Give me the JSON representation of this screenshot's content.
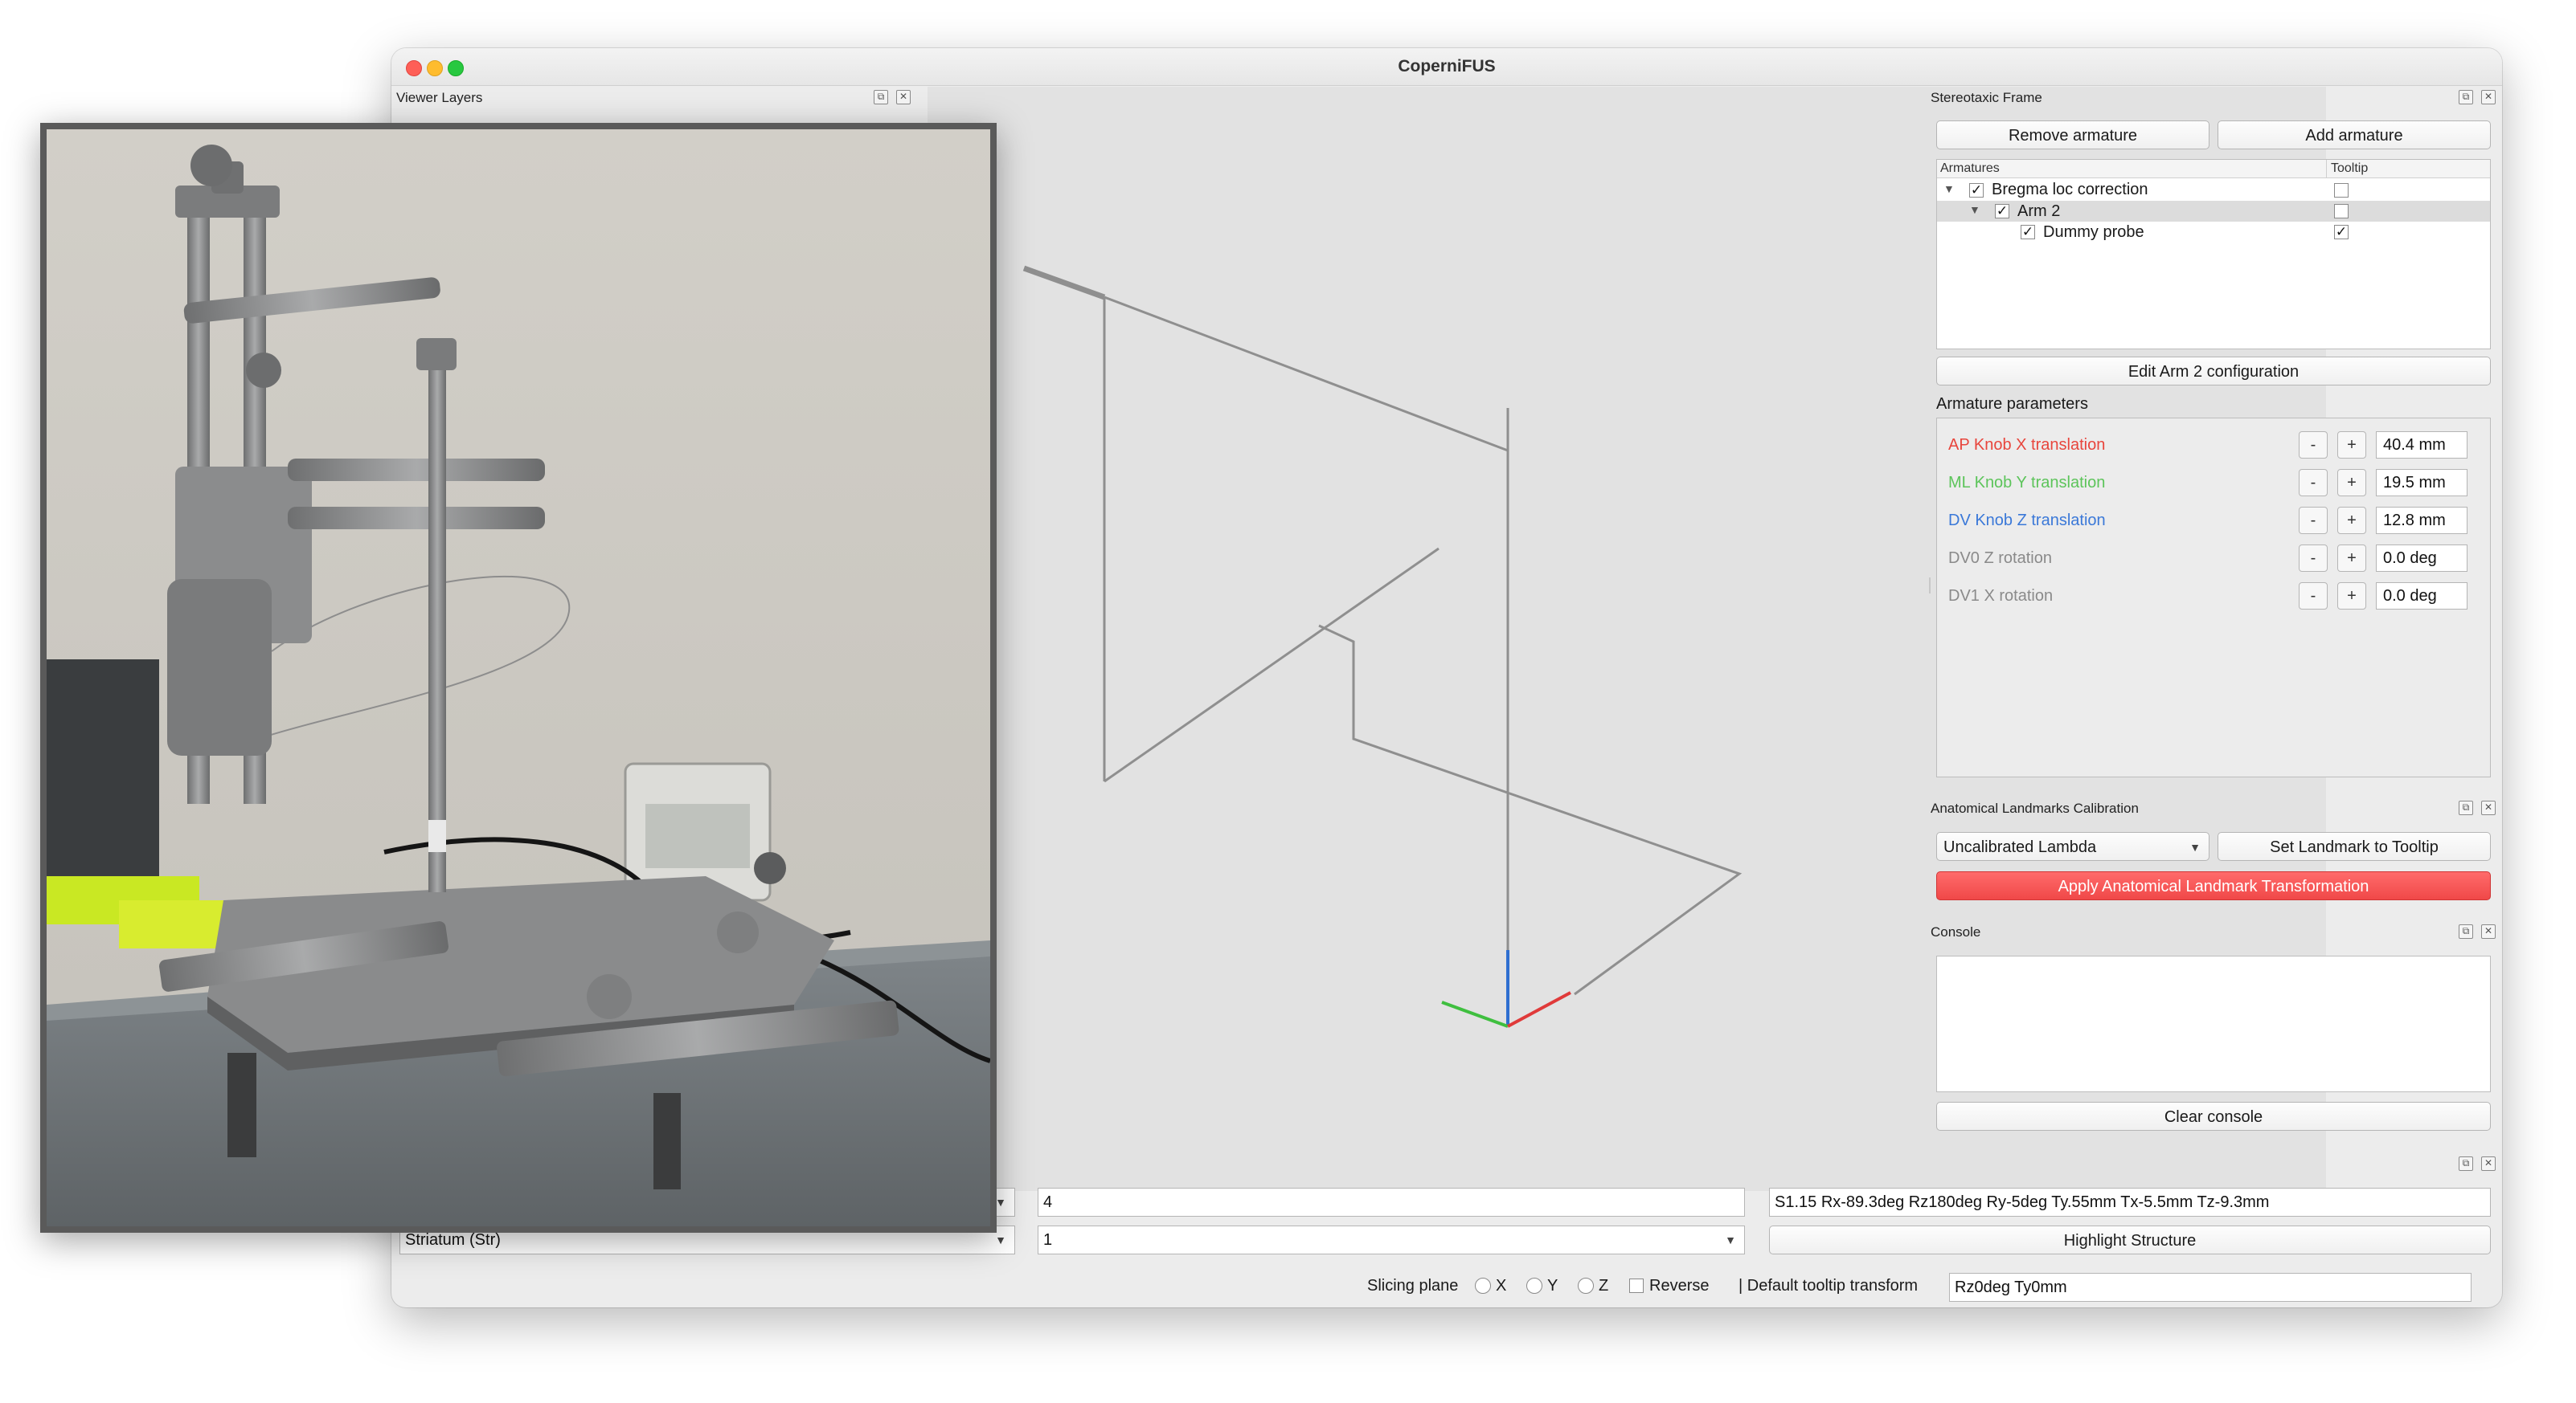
{
  "window": {
    "title": "CoperniFUS"
  },
  "viewer_layers": {
    "title": "Viewer Layers"
  },
  "stereotaxic_frame": {
    "title": "Stereotaxic Frame",
    "remove_armature": "Remove armature",
    "add_armature": "Add armature",
    "tree": {
      "col_armatures": "Armatures",
      "col_tooltip": "Tooltip",
      "rows": [
        {
          "label": "Bregma loc correction",
          "checked": true,
          "tooltip": false
        },
        {
          "label": "Arm 2",
          "checked": true,
          "tooltip": false
        },
        {
          "label": "Dummy probe",
          "checked": true,
          "tooltip": true
        }
      ]
    },
    "edit_config": "Edit Arm 2 configuration",
    "params_title": "Armature parameters",
    "params": [
      {
        "label": "AP Knob X translation",
        "value": "40.4 mm",
        "color": "#e8453c"
      },
      {
        "label": "ML Knob Y translation",
        "value": "19.5 mm",
        "color": "#5cc45a"
      },
      {
        "label": "DV Knob Z translation",
        "value": "12.8 mm",
        "color": "#3a78d8"
      },
      {
        "label": "DV0 Z rotation",
        "value": "0.0 deg",
        "color": "#8a8a8a"
      },
      {
        "label": "DV1 X rotation",
        "value": "0.0 deg",
        "color": "#8a8a8a"
      }
    ],
    "minus": "-",
    "plus": "+"
  },
  "landmarks": {
    "title": "Anatomical Landmarks Calibration",
    "combo_value": "Uncalibrated Lambda",
    "set_button": "Set Landmark to Tooltip",
    "apply_button": "Apply Anatomical Landmark Transformation"
  },
  "console": {
    "title": "Console",
    "clear_button": "Clear console"
  },
  "bottom": {
    "field_index": "4",
    "transform_text": "S1.15 Rx-89.3deg Rz180deg Ry-5deg Ty.55mm Tx-5.5mm Tz-9.3mm",
    "structure": "Striatum (Str)",
    "field_second": "1",
    "highlight_button": "Highlight Structure",
    "slicing_label": "Slicing plane",
    "x_label": "X",
    "y_label": "Y",
    "z_label": "Z",
    "reverse_label": "Reverse",
    "default_tooltip_label": "| Default tooltip transform",
    "default_tooltip_value": "Rz0deg Ty0mm"
  },
  "colors": {
    "apply_red": "#f04848",
    "axis_red": "#e03a3a",
    "axis_green": "#3fbf3f",
    "axis_blue": "#2f6fd0"
  }
}
